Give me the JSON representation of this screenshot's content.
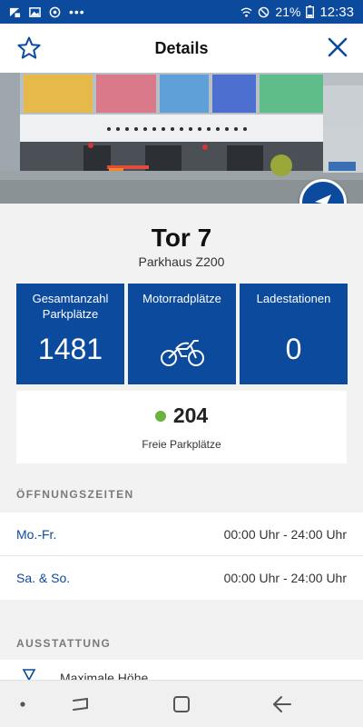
{
  "status_bar": {
    "battery": "21%",
    "time": "12:33",
    "icons": [
      "notification-icon",
      "gallery-icon",
      "sync-icon",
      "more-dots-icon",
      "wifi-icon",
      "do-not-disturb-icon",
      "battery-icon"
    ]
  },
  "header": {
    "title": "Details",
    "favorite_icon": "star-outline-icon",
    "close_icon": "close-icon"
  },
  "hero": {
    "image": "parking-garage-photo",
    "fab_icon": "navigation-arrow-icon"
  },
  "location": {
    "name": "Tor 7",
    "subtitle": "Parkhaus Z200"
  },
  "stats": {
    "total_label": "Gesamtanzahl Parkplätze",
    "total_value": "1481",
    "moto_label": "Motorradplätze",
    "moto_icon": "motorcycle-icon",
    "charging_label": "Ladestationen",
    "charging_value": "0"
  },
  "free": {
    "value": "204",
    "label": "Freie Parkplätze",
    "status_color": "#6bb33b"
  },
  "opening_hours": {
    "heading": "ÖFFNUNGSZEITEN",
    "rows": [
      {
        "day": "Mo.-Fr.",
        "time": "00:00 Uhr - 24:00 Uhr"
      },
      {
        "day": "Sa. & So.",
        "time": "00:00 Uhr - 24:00 Uhr"
      }
    ]
  },
  "equipment": {
    "heading": "AUSSTATTUNG",
    "first_item": "Maximale Höhe"
  },
  "theme": {
    "primary": "#0b4a9c",
    "background": "#f2f2f2"
  }
}
